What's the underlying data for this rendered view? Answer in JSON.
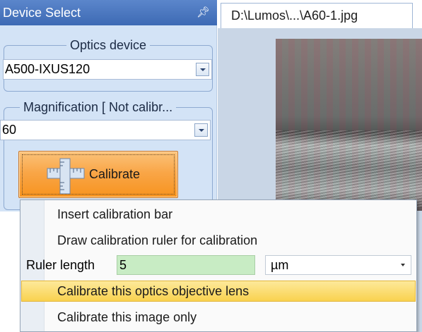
{
  "panel": {
    "title": "Device Select",
    "optics": {
      "legend": "Optics device",
      "value": "A500-IXUS120"
    },
    "magnification": {
      "legend": "Magnification [ Not calibr...",
      "value": "60"
    },
    "calibrate_label": "Calibrate"
  },
  "document": {
    "tab_title": "D:\\Lumos\\...\\A60-1.jpg"
  },
  "menu": {
    "insert_bar": "Insert calibration bar",
    "draw_ruler": "Draw calibration ruler for calibration",
    "ruler_length_label": "Ruler length",
    "ruler_length_value": "5",
    "unit": "µm",
    "calibrate_objective": "Calibrate this optics objective lens",
    "calibrate_image_only": "Calibrate this image only"
  },
  "icons": [
    "pin-icon",
    "chevron-down-icon",
    "ruler-icon"
  ],
  "colors": {
    "header": "#3d6ab4",
    "calibrate_button": "#f7931e",
    "menu_highlight": "#f9d24f",
    "ruler_input": "#c8ecc4"
  }
}
